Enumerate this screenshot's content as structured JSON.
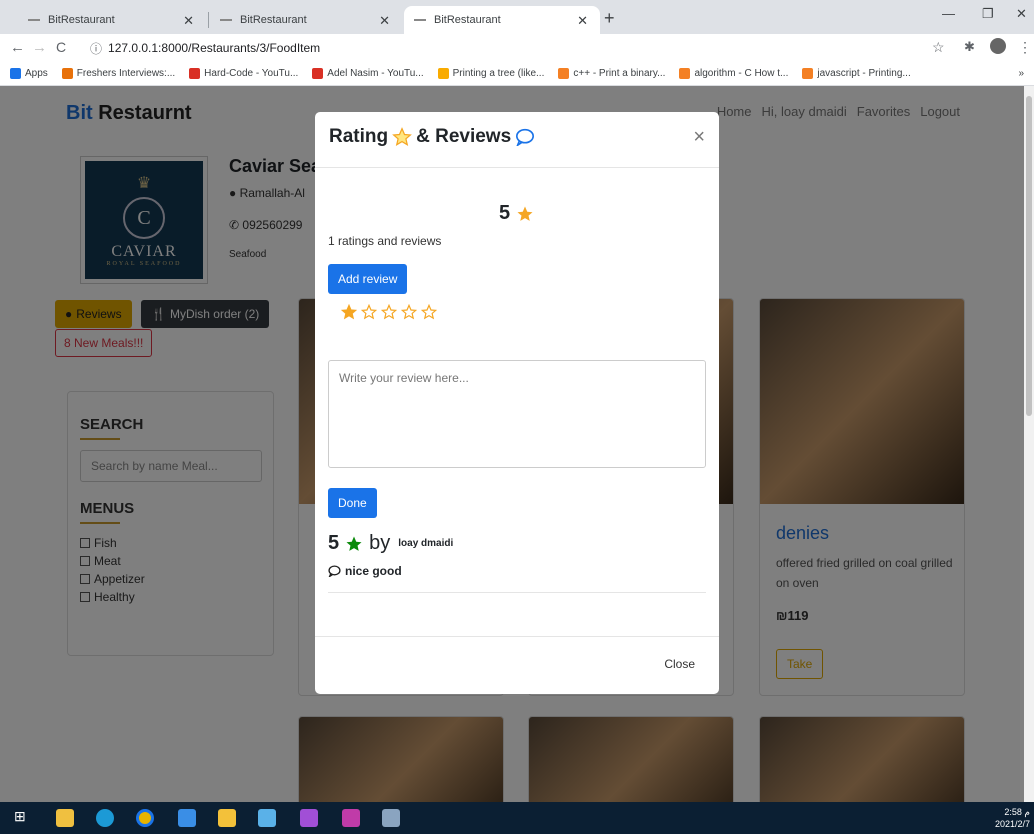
{
  "browser": {
    "tabs": [
      {
        "title": "BitRestaurant"
      },
      {
        "title": "BitRestaurant"
      },
      {
        "title": "BitRestaurant"
      }
    ],
    "url": "127.0.0.1:8000/Restaurants/3/FoodItem",
    "bookmarks": [
      {
        "label": "Apps",
        "color": "#1a73e8"
      },
      {
        "label": "Freshers Interviews:...",
        "color": "#e8710a"
      },
      {
        "label": "Hard-Code - YouTu...",
        "color": "#d93025"
      },
      {
        "label": "Adel Nasim - YouTu...",
        "color": "#d93025"
      },
      {
        "label": "Printing a tree (like...",
        "color": "#f9ab00"
      },
      {
        "label": "c++ - Print a binary...",
        "color": "#f48024"
      },
      {
        "label": "algorithm - C How t...",
        "color": "#f48024"
      },
      {
        "label": "javascript - Printing...",
        "color": "#f48024"
      }
    ],
    "bookmarks_more": "»"
  },
  "site": {
    "brand_prefix": "Bit",
    "brand_suffix": " Restaurnt",
    "nav": [
      "Home",
      "Hi, loay dmaidi",
      "Favorites",
      "Logout"
    ]
  },
  "restaurant": {
    "name": "Caviar Sea",
    "location": "Ramallah-Al",
    "phone": "092560299",
    "category": "Seafood",
    "logo": {
      "crown": "♛",
      "mark": "C",
      "name": "CAVIAR",
      "sub": "ROYAL SEAFOOD"
    }
  },
  "actions": {
    "reviews": "Reviews",
    "mydish": "MyDish order (2)",
    "new_meals": "8 New Meals!!!"
  },
  "sidebar": {
    "search_title": "SEARCH",
    "search_placeholder": "Search by name Meal...",
    "menus_title": "MENUS",
    "menus": [
      "Fish",
      "Meat",
      "Appetizer",
      "Healthy"
    ]
  },
  "card": {
    "title": "denies",
    "description": "offered fried grilled on coal grilled on oven",
    "price": "₪119",
    "take": "Take"
  },
  "modal": {
    "title": "Rating",
    "title_mid": "& Reviews",
    "average": "5",
    "count_text": "1 ratings and reviews",
    "add_review": "Add review",
    "selected_stars": 1,
    "max_stars": 5,
    "placeholder": "Write your review here...",
    "done": "Done",
    "reviews": [
      {
        "rating": "5",
        "by": "by",
        "author": "loay dmaidi",
        "comment": "nice good"
      }
    ],
    "footer_close": "Close",
    "close_symbol": "×"
  },
  "taskbar": {
    "time": "2:58 م",
    "date": "2021/2/7"
  },
  "colors": {
    "accent": "#1a73e8",
    "star_gold": "#f5a623",
    "star_green": "#0a8a0a",
    "warning": "#e0a800",
    "danger": "#dc3545"
  }
}
